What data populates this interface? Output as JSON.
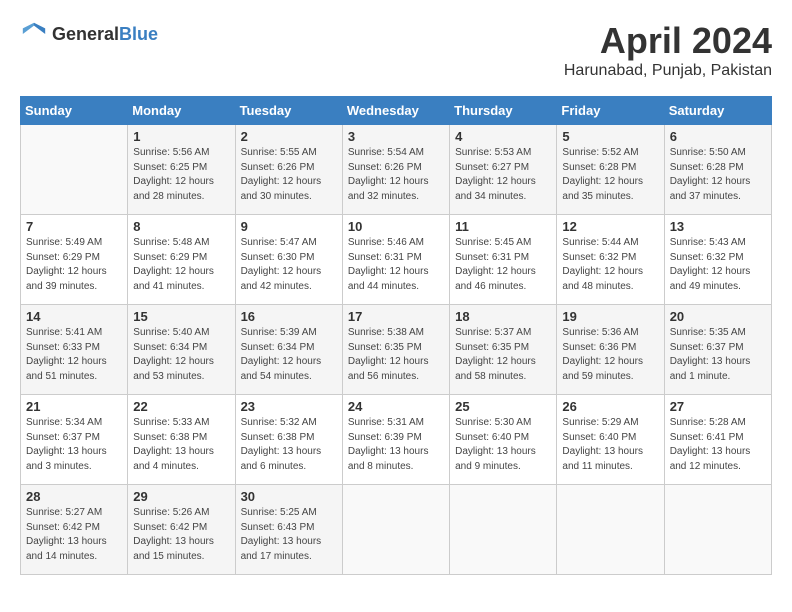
{
  "header": {
    "logo_general": "General",
    "logo_blue": "Blue",
    "month": "April 2024",
    "location": "Harunabad, Punjab, Pakistan"
  },
  "days_of_week": [
    "Sunday",
    "Monday",
    "Tuesday",
    "Wednesday",
    "Thursday",
    "Friday",
    "Saturday"
  ],
  "weeks": [
    [
      {
        "day": "",
        "sunrise": "",
        "sunset": "",
        "daylight": ""
      },
      {
        "day": "1",
        "sunrise": "Sunrise: 5:56 AM",
        "sunset": "Sunset: 6:25 PM",
        "daylight": "Daylight: 12 hours and 28 minutes."
      },
      {
        "day": "2",
        "sunrise": "Sunrise: 5:55 AM",
        "sunset": "Sunset: 6:26 PM",
        "daylight": "Daylight: 12 hours and 30 minutes."
      },
      {
        "day": "3",
        "sunrise": "Sunrise: 5:54 AM",
        "sunset": "Sunset: 6:26 PM",
        "daylight": "Daylight: 12 hours and 32 minutes."
      },
      {
        "day": "4",
        "sunrise": "Sunrise: 5:53 AM",
        "sunset": "Sunset: 6:27 PM",
        "daylight": "Daylight: 12 hours and 34 minutes."
      },
      {
        "day": "5",
        "sunrise": "Sunrise: 5:52 AM",
        "sunset": "Sunset: 6:28 PM",
        "daylight": "Daylight: 12 hours and 35 minutes."
      },
      {
        "day": "6",
        "sunrise": "Sunrise: 5:50 AM",
        "sunset": "Sunset: 6:28 PM",
        "daylight": "Daylight: 12 hours and 37 minutes."
      }
    ],
    [
      {
        "day": "7",
        "sunrise": "Sunrise: 5:49 AM",
        "sunset": "Sunset: 6:29 PM",
        "daylight": "Daylight: 12 hours and 39 minutes."
      },
      {
        "day": "8",
        "sunrise": "Sunrise: 5:48 AM",
        "sunset": "Sunset: 6:29 PM",
        "daylight": "Daylight: 12 hours and 41 minutes."
      },
      {
        "day": "9",
        "sunrise": "Sunrise: 5:47 AM",
        "sunset": "Sunset: 6:30 PM",
        "daylight": "Daylight: 12 hours and 42 minutes."
      },
      {
        "day": "10",
        "sunrise": "Sunrise: 5:46 AM",
        "sunset": "Sunset: 6:31 PM",
        "daylight": "Daylight: 12 hours and 44 minutes."
      },
      {
        "day": "11",
        "sunrise": "Sunrise: 5:45 AM",
        "sunset": "Sunset: 6:31 PM",
        "daylight": "Daylight: 12 hours and 46 minutes."
      },
      {
        "day": "12",
        "sunrise": "Sunrise: 5:44 AM",
        "sunset": "Sunset: 6:32 PM",
        "daylight": "Daylight: 12 hours and 48 minutes."
      },
      {
        "day": "13",
        "sunrise": "Sunrise: 5:43 AM",
        "sunset": "Sunset: 6:32 PM",
        "daylight": "Daylight: 12 hours and 49 minutes."
      }
    ],
    [
      {
        "day": "14",
        "sunrise": "Sunrise: 5:41 AM",
        "sunset": "Sunset: 6:33 PM",
        "daylight": "Daylight: 12 hours and 51 minutes."
      },
      {
        "day": "15",
        "sunrise": "Sunrise: 5:40 AM",
        "sunset": "Sunset: 6:34 PM",
        "daylight": "Daylight: 12 hours and 53 minutes."
      },
      {
        "day": "16",
        "sunrise": "Sunrise: 5:39 AM",
        "sunset": "Sunset: 6:34 PM",
        "daylight": "Daylight: 12 hours and 54 minutes."
      },
      {
        "day": "17",
        "sunrise": "Sunrise: 5:38 AM",
        "sunset": "Sunset: 6:35 PM",
        "daylight": "Daylight: 12 hours and 56 minutes."
      },
      {
        "day": "18",
        "sunrise": "Sunrise: 5:37 AM",
        "sunset": "Sunset: 6:35 PM",
        "daylight": "Daylight: 12 hours and 58 minutes."
      },
      {
        "day": "19",
        "sunrise": "Sunrise: 5:36 AM",
        "sunset": "Sunset: 6:36 PM",
        "daylight": "Daylight: 12 hours and 59 minutes."
      },
      {
        "day": "20",
        "sunrise": "Sunrise: 5:35 AM",
        "sunset": "Sunset: 6:37 PM",
        "daylight": "Daylight: 13 hours and 1 minute."
      }
    ],
    [
      {
        "day": "21",
        "sunrise": "Sunrise: 5:34 AM",
        "sunset": "Sunset: 6:37 PM",
        "daylight": "Daylight: 13 hours and 3 minutes."
      },
      {
        "day": "22",
        "sunrise": "Sunrise: 5:33 AM",
        "sunset": "Sunset: 6:38 PM",
        "daylight": "Daylight: 13 hours and 4 minutes."
      },
      {
        "day": "23",
        "sunrise": "Sunrise: 5:32 AM",
        "sunset": "Sunset: 6:38 PM",
        "daylight": "Daylight: 13 hours and 6 minutes."
      },
      {
        "day": "24",
        "sunrise": "Sunrise: 5:31 AM",
        "sunset": "Sunset: 6:39 PM",
        "daylight": "Daylight: 13 hours and 8 minutes."
      },
      {
        "day": "25",
        "sunrise": "Sunrise: 5:30 AM",
        "sunset": "Sunset: 6:40 PM",
        "daylight": "Daylight: 13 hours and 9 minutes."
      },
      {
        "day": "26",
        "sunrise": "Sunrise: 5:29 AM",
        "sunset": "Sunset: 6:40 PM",
        "daylight": "Daylight: 13 hours and 11 minutes."
      },
      {
        "day": "27",
        "sunrise": "Sunrise: 5:28 AM",
        "sunset": "Sunset: 6:41 PM",
        "daylight": "Daylight: 13 hours and 12 minutes."
      }
    ],
    [
      {
        "day": "28",
        "sunrise": "Sunrise: 5:27 AM",
        "sunset": "Sunset: 6:42 PM",
        "daylight": "Daylight: 13 hours and 14 minutes."
      },
      {
        "day": "29",
        "sunrise": "Sunrise: 5:26 AM",
        "sunset": "Sunset: 6:42 PM",
        "daylight": "Daylight: 13 hours and 15 minutes."
      },
      {
        "day": "30",
        "sunrise": "Sunrise: 5:25 AM",
        "sunset": "Sunset: 6:43 PM",
        "daylight": "Daylight: 13 hours and 17 minutes."
      },
      {
        "day": "",
        "sunrise": "",
        "sunset": "",
        "daylight": ""
      },
      {
        "day": "",
        "sunrise": "",
        "sunset": "",
        "daylight": ""
      },
      {
        "day": "",
        "sunrise": "",
        "sunset": "",
        "daylight": ""
      },
      {
        "day": "",
        "sunrise": "",
        "sunset": "",
        "daylight": ""
      }
    ]
  ]
}
